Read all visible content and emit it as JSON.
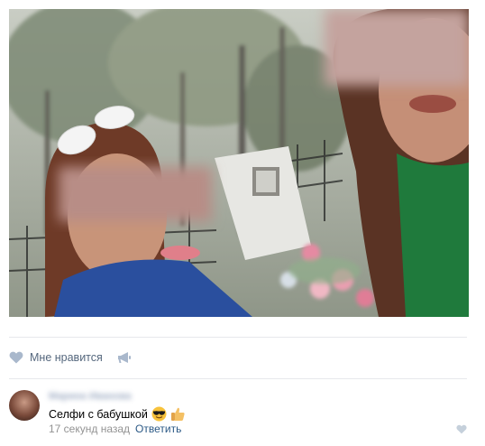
{
  "post": {
    "photo": {
      "icon": "photo-image",
      "palette": [
        "#6b7468",
        "#b8bdb3",
        "#5a3324",
        "#1f7a3c",
        "#e8e8e4",
        "#e79aa8"
      ]
    },
    "actions": {
      "like_label": "Мне нравится",
      "like_icon": "heart-icon",
      "share_icon": "megaphone-icon"
    }
  },
  "comment": {
    "author": "Марина Иванова",
    "text": "Селфи с бабушкой",
    "emojis": [
      "sunglasses-emoji",
      "thumbs-up-emoji"
    ],
    "time": "17 секунд назад",
    "reply_label": "Ответить",
    "like_icon": "heart-icon"
  },
  "colors": {
    "link": "#2a5885",
    "meta": "#939393",
    "action": "#55677d",
    "icon": "#a9b8cc",
    "divider": "#e7e8ec"
  }
}
